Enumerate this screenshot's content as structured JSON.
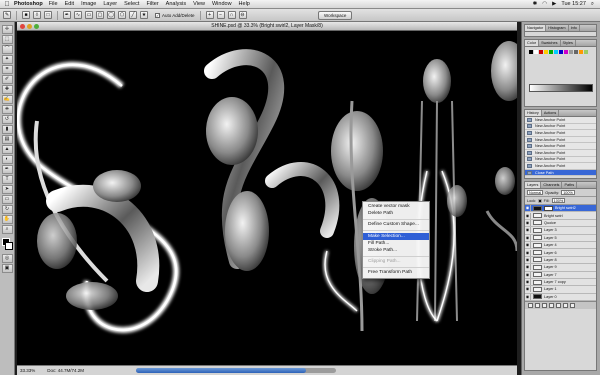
{
  "menubar": {
    "app_name": "Photoshop",
    "menus": [
      "File",
      "Edit",
      "Image",
      "Layer",
      "Select",
      "Filter",
      "Analysis",
      "View",
      "Window",
      "Help"
    ],
    "clock": "Tue 15:27"
  },
  "options_bar": {
    "auto_add_delete_label": "Auto Add/Delete",
    "workspace_label": "Workspace"
  },
  "document": {
    "title": "SHINE.psd @ 33.3% (Bright swirl2, Layer Mask/8)",
    "zoom": "33.33%",
    "doc_size": "Doc: 44.7M/74.2M"
  },
  "context_menu": {
    "items": [
      {
        "label": "Create vector mask",
        "state": "normal"
      },
      {
        "label": "Delete Path",
        "state": "normal"
      },
      {
        "divider": true
      },
      {
        "label": "Define Custom Shape...",
        "state": "normal"
      },
      {
        "divider": true
      },
      {
        "label": "Make Selection...",
        "state": "selected"
      },
      {
        "label": "Fill Path...",
        "state": "normal"
      },
      {
        "label": "Stroke Path...",
        "state": "normal"
      },
      {
        "divider": true
      },
      {
        "label": "Clipping Path...",
        "state": "disabled"
      },
      {
        "divider": true
      },
      {
        "label": "Free Transform Path",
        "state": "normal"
      }
    ]
  },
  "panels": {
    "navigator_tabs": [
      "Navigator",
      "Histogram",
      "Info"
    ],
    "color_tabs": [
      "Color",
      "Swatches",
      "Styles"
    ],
    "history_tabs": [
      "History",
      "Actions"
    ],
    "history_items": [
      "New Anchor Point",
      "New Anchor Point",
      "New Anchor Point",
      "New Anchor Point",
      "New Anchor Point",
      "New Anchor Point",
      "New Anchor Point",
      "New Anchor Point",
      "Close Path"
    ],
    "history_selected": 8,
    "layers_tabs": [
      "Layers",
      "Channels",
      "Paths"
    ],
    "blend_mode": "Normal",
    "opacity_label": "Opacity:",
    "opacity_value": "100%",
    "lock_label": "Lock:",
    "fill_label": "Fill:",
    "fill_value": "100%",
    "layers": [
      "Bright swirl2",
      "Bright swirl",
      "Quoice",
      "Layer 3",
      "Layer 5",
      "Layer 4",
      "Layer 6",
      "Layer 8",
      "Layer 9",
      "Layer 7",
      "Layer 7 copy",
      "Layer 1",
      "Layer 0"
    ],
    "layer_selected": 0
  }
}
